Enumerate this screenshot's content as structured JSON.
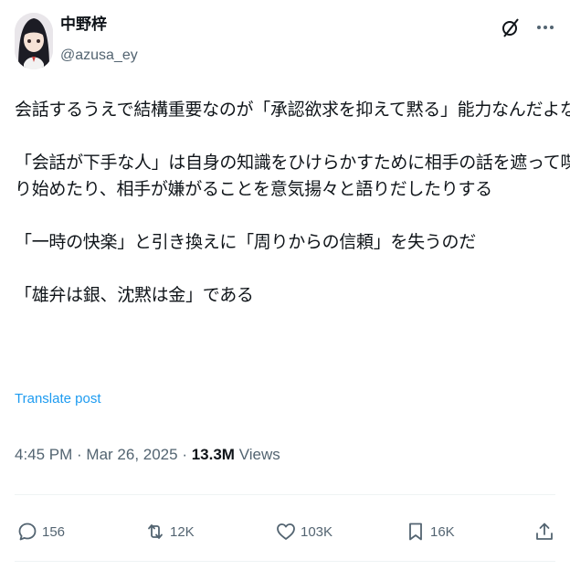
{
  "author": {
    "display_name": "中野梓",
    "handle": "@azusa_ey"
  },
  "icons": {
    "grok": "grok-icon",
    "more": "more-icon",
    "reply": "reply-icon",
    "repost": "repost-icon",
    "like": "heart-icon",
    "bookmark": "bookmark-icon",
    "share": "share-icon"
  },
  "post": {
    "lines": [
      "会話するうえで結構重要なのが「承認欲求を抑えて黙る」能力なんだよな",
      "「会話が下手な人」は自身の知識をひけらかすために相手の話を遮って喋",
      "り始めたり、相手が嫌がることを意気揚々と語りだしたりする",
      "「一時の快楽」と引き換えに「周りからの信頼」を失うのだ",
      "「雄弁は銀、沈黙は金」である"
    ],
    "translate_label": "Translate post"
  },
  "meta": {
    "time": "4:45 PM",
    "separator": " · ",
    "date": "Mar 26, 2025",
    "views_count": "13.3M",
    "views_label": "Views"
  },
  "actions": {
    "replies": "156",
    "reposts": "12K",
    "likes": "103K",
    "bookmarks": "16K"
  },
  "colors": {
    "text": "#0f1419",
    "secondary": "#536471",
    "link": "#1d9bf0",
    "divider": "#eff3f4"
  }
}
